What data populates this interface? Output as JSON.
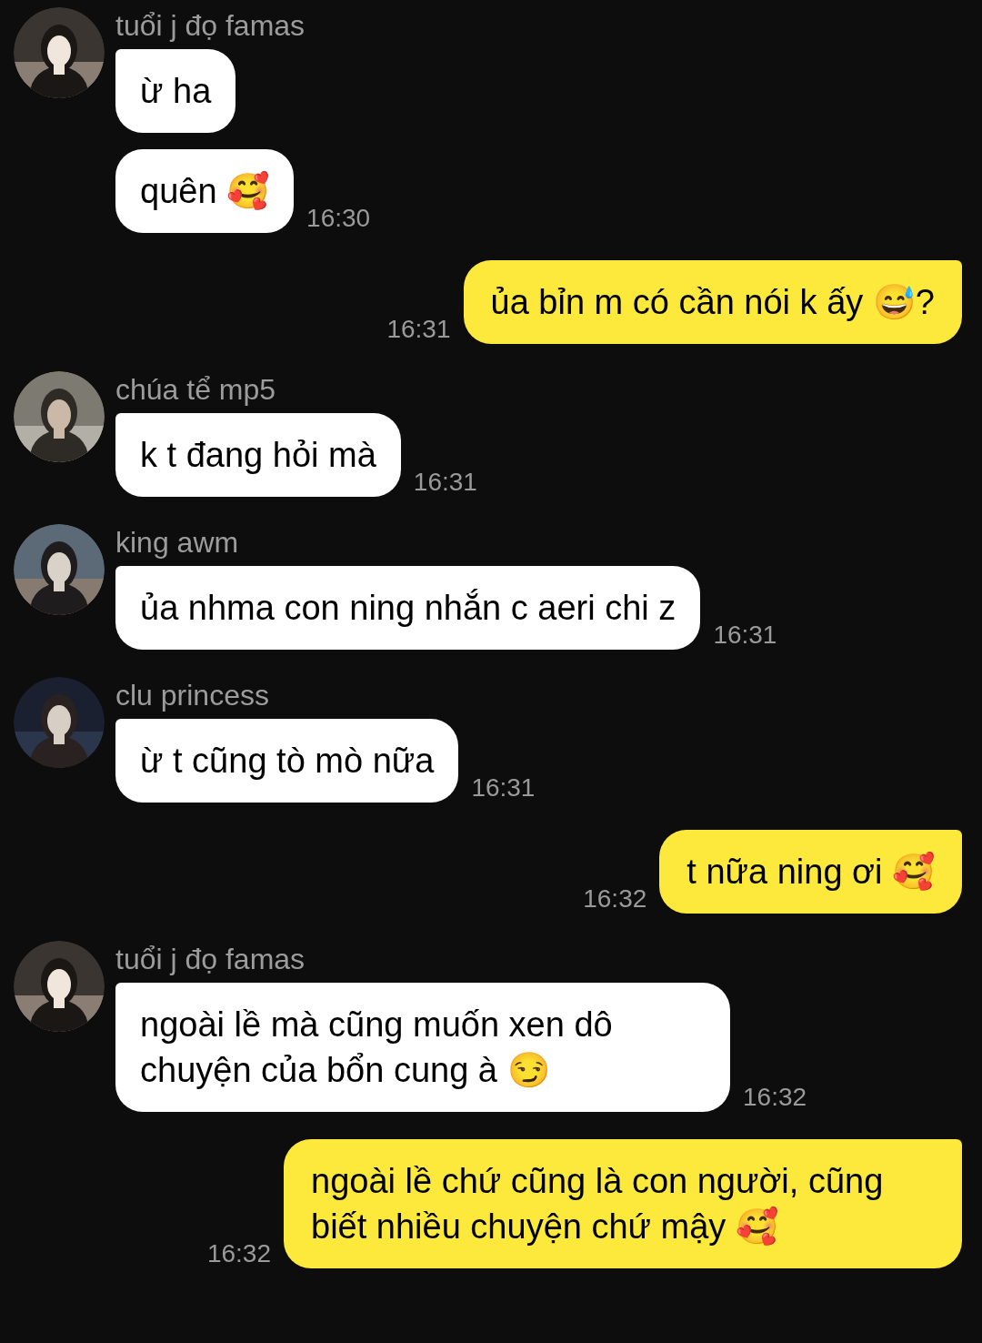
{
  "messages": [
    {
      "kind": "incoming",
      "sender": "tuổi j đọ famas",
      "text": "ừ ha"
    },
    {
      "kind": "incoming",
      "text": "quên 🥰",
      "time": "16:30"
    },
    {
      "kind": "outgoing",
      "text": "ủa bỉn m có cần nói k ấy 😅?",
      "time": "16:31"
    },
    {
      "kind": "incoming",
      "sender": "chúa tể mp5",
      "text": "k t đang hỏi mà",
      "time": "16:31"
    },
    {
      "kind": "incoming",
      "sender": "king awm",
      "text": "ủa nhma con ning nhắn c aeri chi z",
      "time": "16:31"
    },
    {
      "kind": "incoming",
      "sender": "clu princess",
      "text": "ừ t cũng tò mò nữa",
      "time": "16:31"
    },
    {
      "kind": "outgoing",
      "text": "t nữa ning ơi 🥰",
      "time": "16:32"
    },
    {
      "kind": "incoming",
      "sender": "tuổi j đọ famas",
      "text": "ngoài lề mà cũng muốn xen dô chuyện của bổn cung à 😏",
      "time": "16:32"
    },
    {
      "kind": "outgoing",
      "text": "ngoài lề chứ cũng là con người, cũng biết nhiều chuyện chứ mậy 🥰",
      "time": "16:32"
    }
  ]
}
